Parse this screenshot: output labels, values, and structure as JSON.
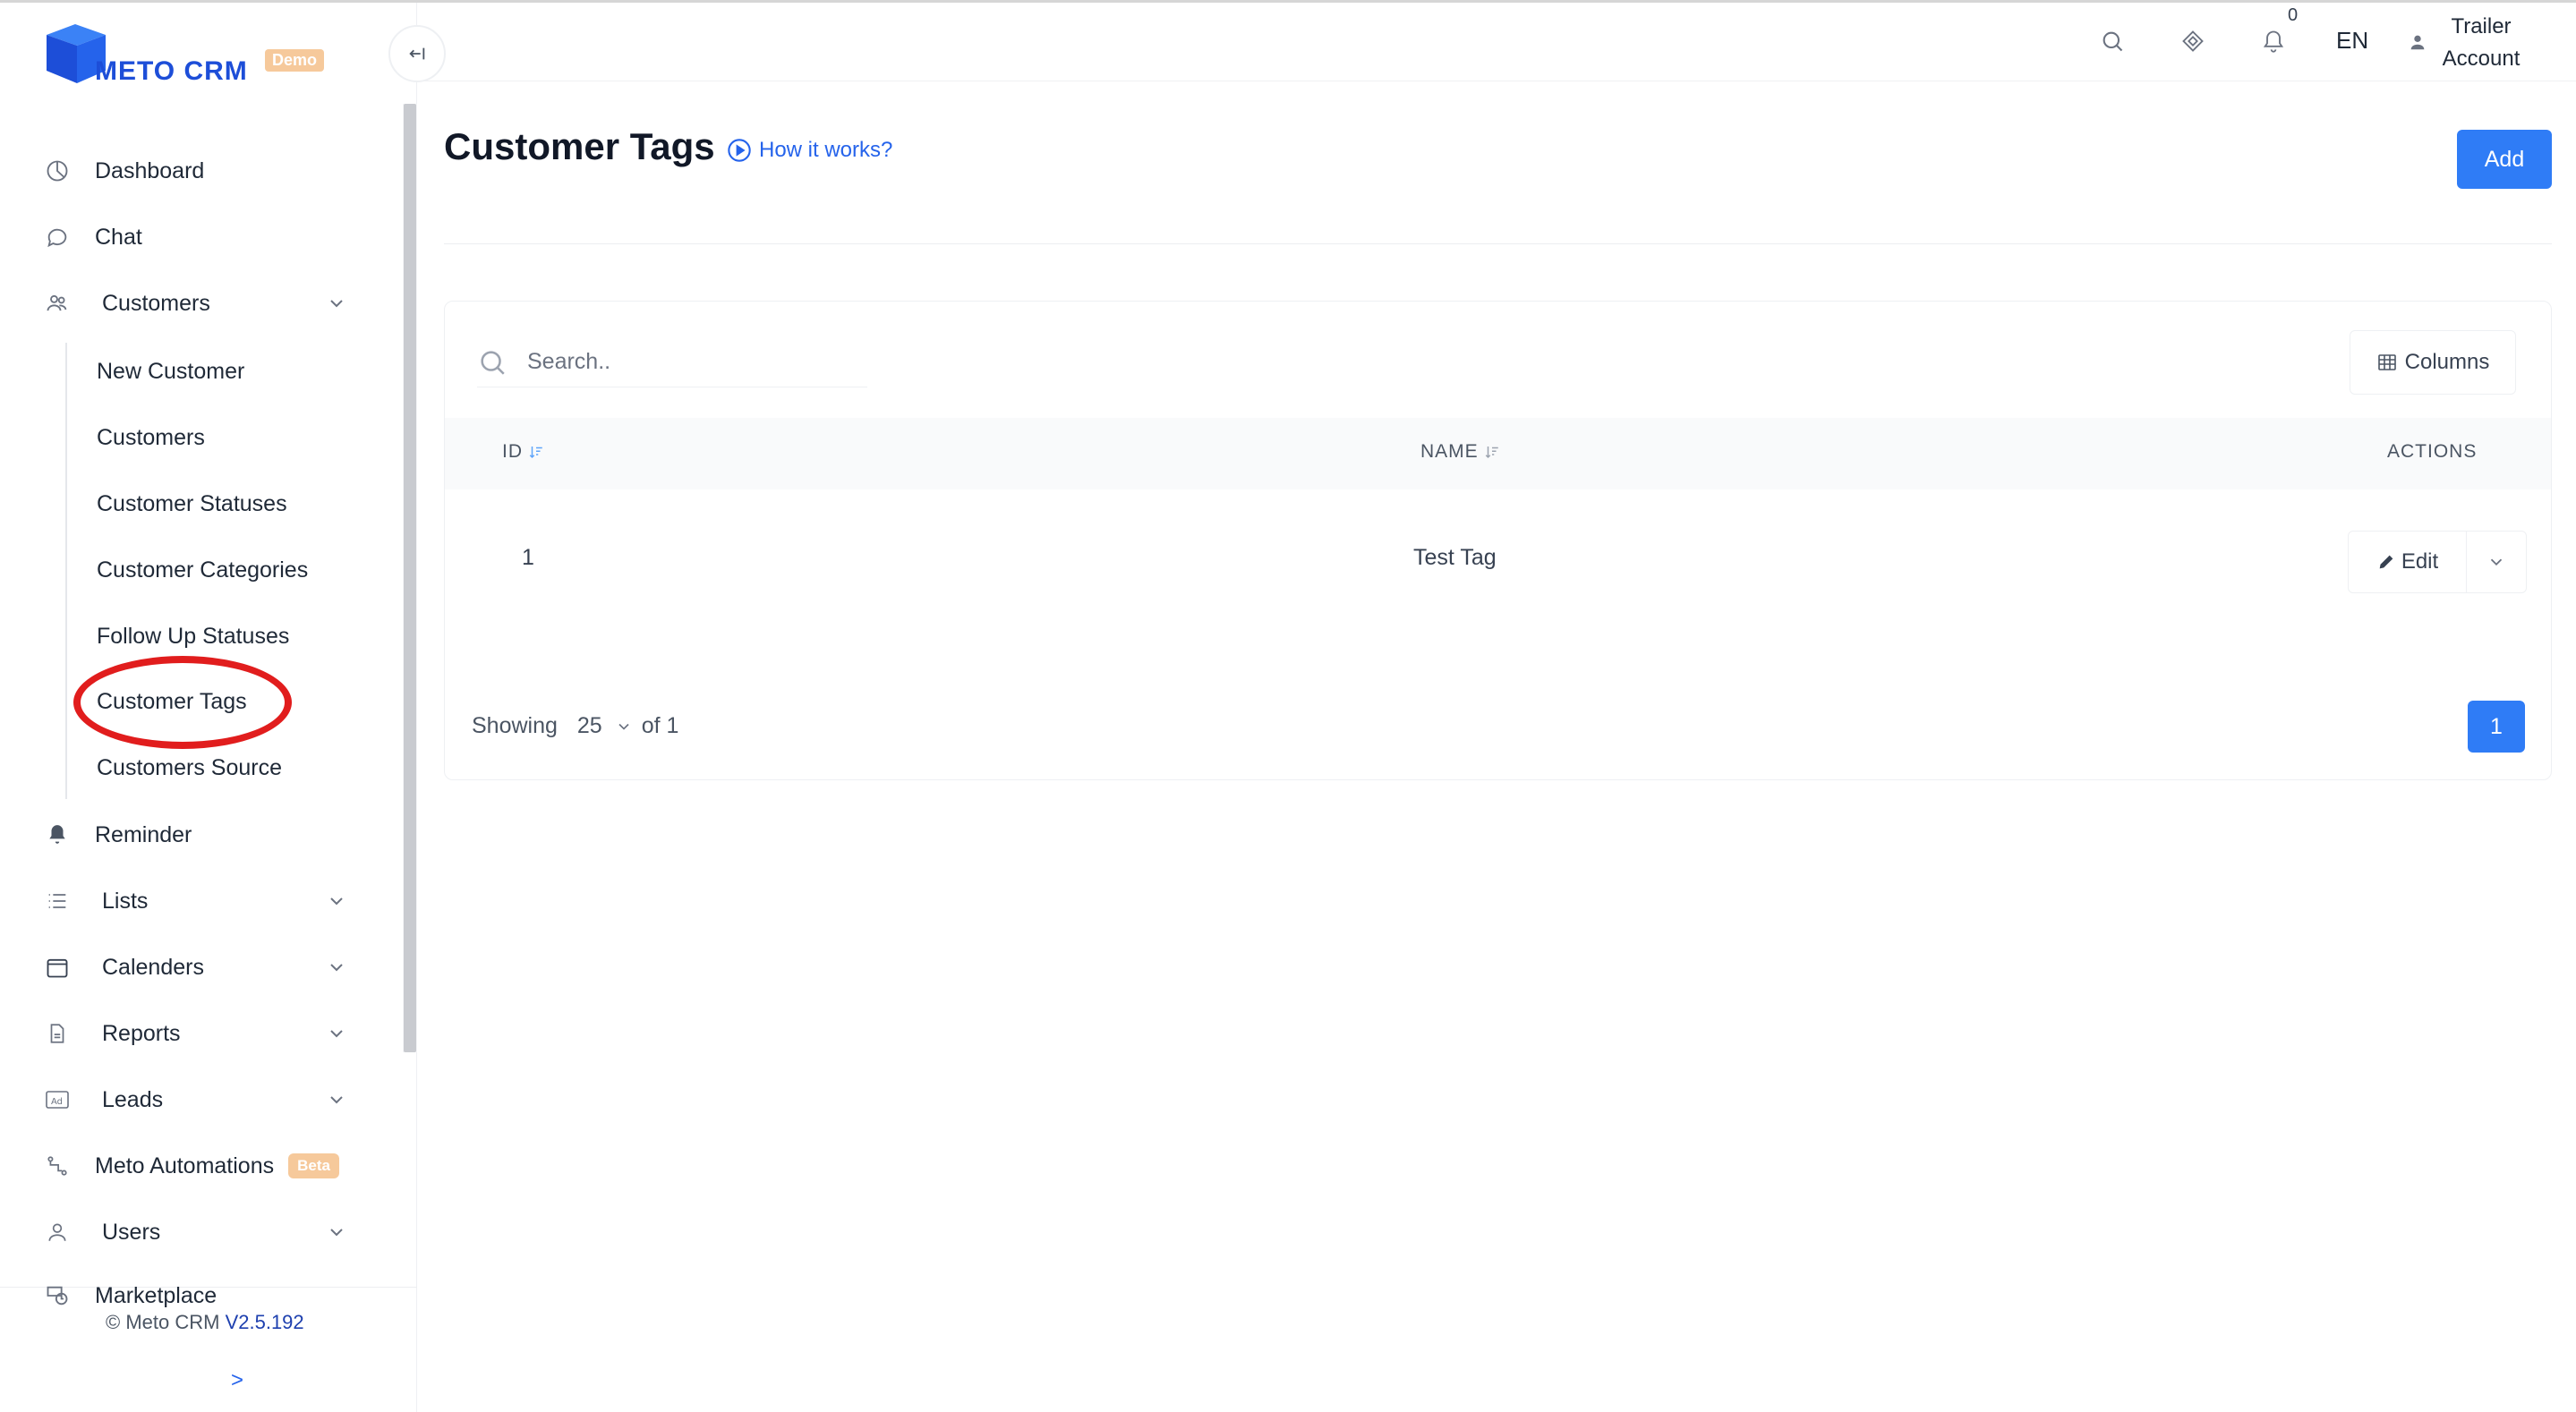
{
  "brand": {
    "name": "METO CRM",
    "badge": "Demo"
  },
  "sidebar": {
    "items": [
      {
        "label": "Dashboard",
        "icon": "pie-chart-icon"
      },
      {
        "label": "Chat",
        "icon": "chat-bubble-icon"
      },
      {
        "label": "Customers",
        "icon": "users-icon",
        "expanded": true,
        "children": [
          "New Customer",
          "Customers",
          "Customer Statuses",
          "Customer Categories",
          "Follow Up Statuses",
          "Customer Tags",
          "Customers Source"
        ]
      },
      {
        "label": "Reminder",
        "icon": "bell-icon"
      },
      {
        "label": "Lists",
        "icon": "list-icon"
      },
      {
        "label": "Calenders",
        "icon": "calendar-icon"
      },
      {
        "label": "Reports",
        "icon": "document-icon"
      },
      {
        "label": "Leads",
        "icon": "ad-icon"
      },
      {
        "label": "Meto Automations",
        "icon": "flow-icon",
        "badge": "Beta"
      },
      {
        "label": "Users",
        "icon": "user-icon"
      },
      {
        "label": "Marketplace",
        "icon": "store-icon"
      }
    ],
    "active_child": "Customer Tags",
    "footer": {
      "copyright": "© Meto CRM",
      "version": "V2.5.192",
      "expand": ">"
    }
  },
  "header": {
    "notification_count": "0",
    "language": "EN",
    "account_line1": "Trailer",
    "account_line2": "Account"
  },
  "main": {
    "title": "Customer Tags",
    "help_link": "How it works?",
    "add_label": "Add",
    "search_placeholder": "Search..",
    "columns_label": "Columns",
    "table": {
      "headers": [
        "ID",
        "NAME",
        "ACTIONS"
      ],
      "rows": [
        {
          "id": "1",
          "name": "Test Tag",
          "action": "Edit"
        }
      ]
    },
    "pagination": {
      "showing": "Showing",
      "page_size": "25",
      "of": "of 1",
      "current_page": "1"
    }
  },
  "colors": {
    "primary": "#2f7cf6",
    "brand": "#1d4ed8",
    "badge": "#f6c99b",
    "highlight": "#e11d1d"
  }
}
